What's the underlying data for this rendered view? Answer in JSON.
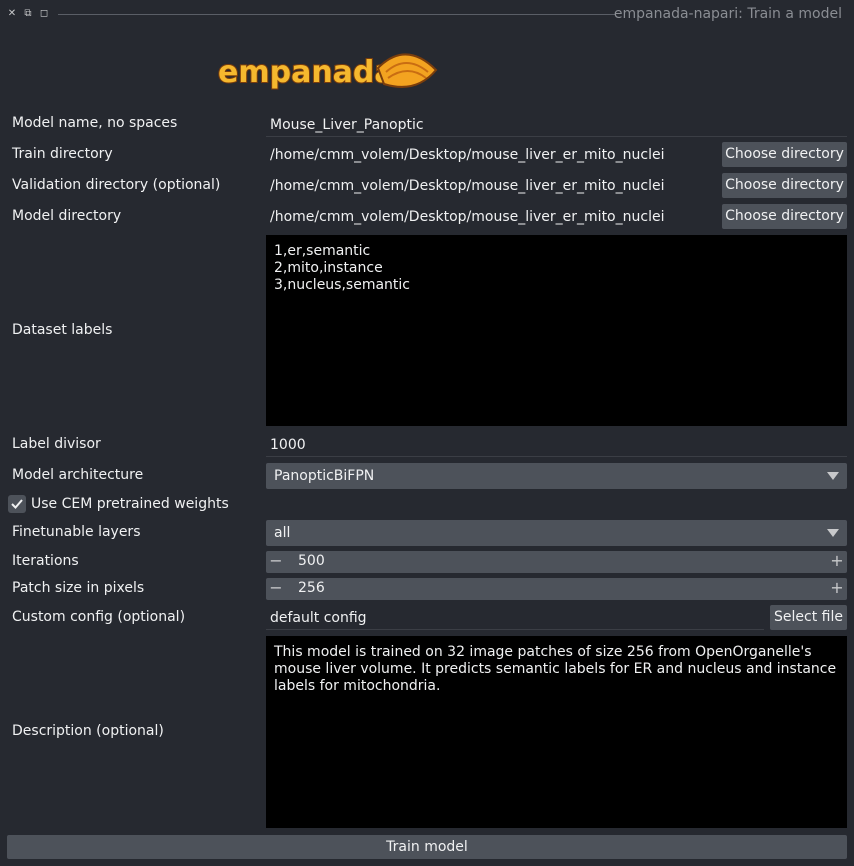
{
  "window": {
    "title": "empanada-napari: Train a model",
    "controls": [
      "close-icon",
      "float-icon",
      "maximize-icon"
    ]
  },
  "logo": {
    "text": "empanada"
  },
  "form": {
    "model_name": {
      "label": "Model name, no spaces",
      "value": "Mouse_Liver_Panoptic"
    },
    "train_dir": {
      "label": "Train directory",
      "value": "/home/cmm_volem/Desktop/mouse_liver_er_mito_nuclei",
      "button": "Choose directory"
    },
    "val_dir": {
      "label": "Validation directory (optional)",
      "value": "/home/cmm_volem/Desktop/mouse_liver_er_mito_nuclei",
      "button": "Choose directory"
    },
    "model_dir": {
      "label": "Model directory",
      "value": "/home/cmm_volem/Desktop/mouse_liver_er_mito_nuclei",
      "button": "Choose directory"
    },
    "dataset_labels": {
      "label": "Dataset labels",
      "value": "1,er,semantic\n2,mito,instance\n3,nucleus,semantic"
    },
    "label_divisor": {
      "label": "Label divisor",
      "value": "1000"
    },
    "architecture": {
      "label": "Model architecture",
      "value": "PanopticBiFPN"
    },
    "cem_weights": {
      "label": "Use CEM pretrained weights",
      "checked": true
    },
    "finetunable": {
      "label": "Finetunable layers",
      "value": "all"
    },
    "iterations": {
      "label": "Iterations",
      "value": "500",
      "minus": "−",
      "plus": "+"
    },
    "patch_size": {
      "label": "Patch size in pixels",
      "value": "256",
      "minus": "−",
      "plus": "+"
    },
    "custom_config": {
      "label": "Custom config (optional)",
      "value": "default config",
      "button": "Select file"
    },
    "description": {
      "label": "Description (optional)",
      "value": "This model is trained on 32 image patches of size 256 from OpenOrganelle's mouse liver volume. It predicts semantic labels for ER and nucleus and instance labels for mitochondria."
    }
  },
  "train_button": "Train model",
  "colors": {
    "background": "#262930",
    "button": "#4d525a",
    "textarea": "#000000",
    "text": "#f0f1f2"
  }
}
